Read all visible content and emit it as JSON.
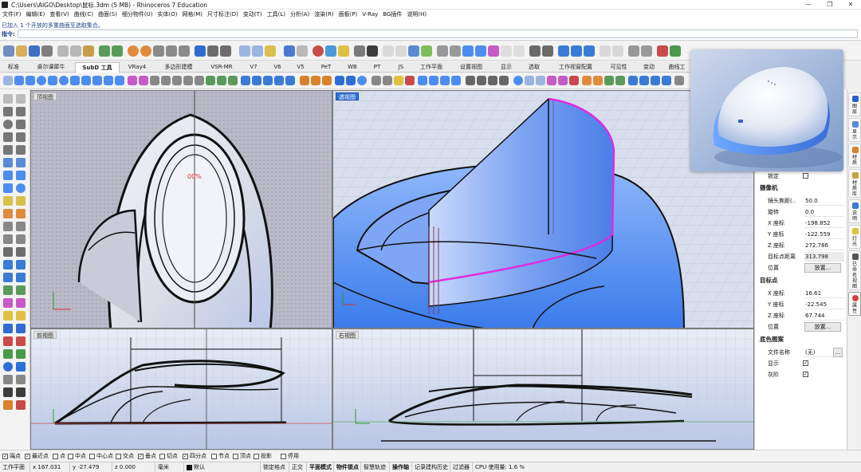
{
  "window": {
    "title": "C:\\Users\\AIGO\\Desktop\\鼠标.3dm (5 MB) - Rhinoceros 7 Education",
    "controls": [
      "—",
      "❐",
      "✕"
    ]
  },
  "menu": [
    "文件(F)",
    "编辑(E)",
    "查看(V)",
    "曲线(C)",
    "曲面(S)",
    "细分物件(U)",
    "实体(O)",
    "网格(M)",
    "尺寸标注(D)",
    "变动(T)",
    "工具(L)",
    "分析(A)",
    "渲染(R)",
    "面板(P)",
    "V-Ray",
    "BG插件",
    "说明(H)"
  ],
  "command": {
    "history": "已加入 1 个开放的多重曲面至选取集合。",
    "prompt": "指令:"
  },
  "tabs": [
    {
      "label": "标准",
      "active": false
    },
    {
      "label": "桌尔课犀牛",
      "active": false
    },
    {
      "label": "SubD 工具",
      "active": true
    },
    {
      "label": "VRay4",
      "active": false
    },
    {
      "label": "多边形建模",
      "active": false
    },
    {
      "label": "VSR-MR",
      "active": false
    },
    {
      "label": "V7",
      "active": false
    },
    {
      "label": "V6",
      "active": false
    },
    {
      "label": "V5",
      "active": false
    },
    {
      "label": "PeT",
      "active": false
    },
    {
      "label": "WB",
      "active": false
    },
    {
      "label": "PT",
      "active": false
    },
    {
      "label": "JS",
      "active": false
    },
    {
      "label": "工作平面",
      "active": false
    },
    {
      "label": "设置视图",
      "active": false
    },
    {
      "label": "显示",
      "active": false
    },
    {
      "label": "选取",
      "active": false
    },
    {
      "label": "工作视窗配置",
      "active": false
    },
    {
      "label": "可见性",
      "active": false
    },
    {
      "label": "变动",
      "active": false
    },
    {
      "label": "曲线工",
      "active": false
    }
  ],
  "viewports": {
    "top": {
      "label": "顶视图"
    },
    "perspective": {
      "label": "透视图"
    },
    "front": {
      "label": "前视图"
    },
    "right": {
      "label": "右视图"
    }
  },
  "properties": {
    "lock_label": "锁定",
    "camera_section": "摄像机",
    "camera": [
      {
        "label": "镜头焦距(..",
        "value": "50.0"
      },
      {
        "label": "旋转",
        "value": "0.0"
      },
      {
        "label": "X 座标",
        "value": "-198.852"
      },
      {
        "label": "Y 座标",
        "value": "-122.559"
      },
      {
        "label": "Z 座标",
        "value": "272.786"
      },
      {
        "label": "目标点距离",
        "value": "313.798"
      }
    ],
    "position_label": "位置",
    "place_button": "放置...",
    "target_section": "目标点",
    "target": [
      {
        "label": "X 座标",
        "value": "16.61"
      },
      {
        "label": "Y 座标",
        "value": "-22.545"
      },
      {
        "label": "Z 座标",
        "value": "67.744"
      }
    ],
    "target_position_label": "位置",
    "target_place_button": "放置...",
    "underlay_section": "底色图案",
    "filename_label": "文件名称",
    "filename_value": "(无)",
    "browse_button": "...",
    "show_label": "显示",
    "gray_label": "灰阶"
  },
  "right_tabs": [
    {
      "label": "图层",
      "color": "#2b62c9"
    },
    {
      "label": "显示",
      "color": "#5a8ad6"
    },
    {
      "label": "材质",
      "color": "#d9822b"
    },
    {
      "label": "材质库",
      "color": "#c8a13a"
    },
    {
      "label": "说明",
      "color": "#3a7bd5"
    },
    {
      "label": "灯光",
      "color": "#e0c23a"
    },
    {
      "label": "已命名视图",
      "color": "#555555"
    },
    {
      "label": "属性",
      "color": "#d33f3f"
    }
  ],
  "osnaps": [
    {
      "label": "端点",
      "checked": true
    },
    {
      "label": "最近点",
      "checked": true
    },
    {
      "label": "点",
      "checked": false
    },
    {
      "label": "中点",
      "checked": false
    },
    {
      "label": "中心点",
      "checked": false
    },
    {
      "label": "交点",
      "checked": false
    },
    {
      "label": "垂点",
      "checked": true
    },
    {
      "label": "切点",
      "checked": false
    },
    {
      "label": "四分点",
      "checked": true
    },
    {
      "label": "节点",
      "checked": false
    },
    {
      "label": "顶点",
      "checked": false
    },
    {
      "label": "投影",
      "checked": false
    },
    {
      "label": "停用",
      "checked": false
    }
  ],
  "status": {
    "cplane": "工作平面",
    "x": "x 167.031",
    "y": "y -27.479",
    "z": "z 0.000",
    "units": "毫米",
    "layer": "默认",
    "items": [
      "锁定格点",
      "正交",
      "平面模式",
      "物件锁点",
      "智慧轨迹",
      "操作轴",
      "记录建构历史",
      "过滤器"
    ],
    "cpu": "CPU 使用量: 1.6 %"
  },
  "colors": {
    "accent": "#2d6fd8",
    "surface_blue": "#4d8cf0",
    "edge_magenta": "#e02ae0",
    "viewport_bg": "#c8d4ea"
  }
}
